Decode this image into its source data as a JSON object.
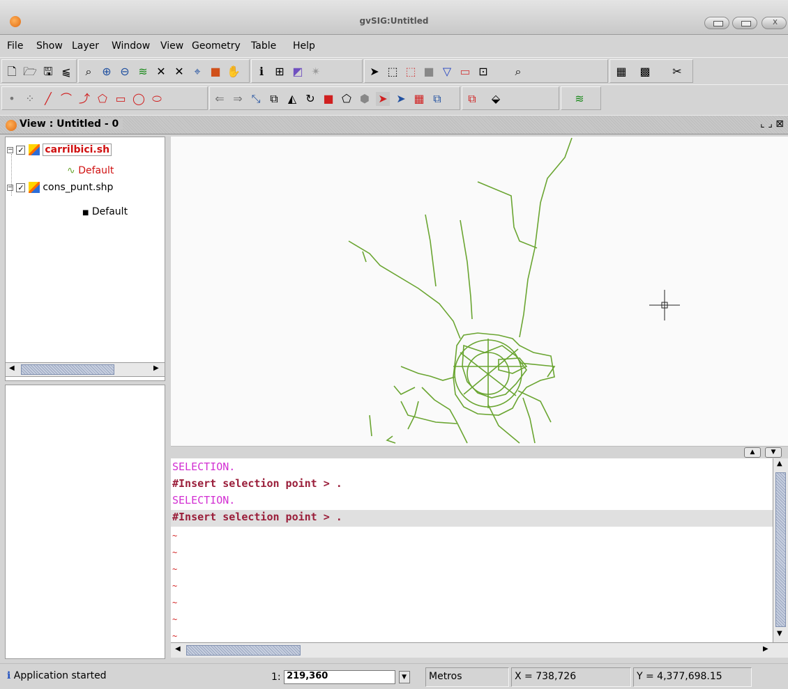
{
  "window": {
    "title": "gvSIG:Untitled"
  },
  "menu": [
    "File",
    "Show",
    "Layer",
    "Window",
    "View",
    "Geometry",
    "Table",
    "Help"
  ],
  "view": {
    "title": "View : Untitled - 0"
  },
  "toc": {
    "layers": [
      {
        "name": "carrilbici.sh",
        "legend": "Default",
        "checked": true,
        "active": true
      },
      {
        "name": "cons_punt.shp",
        "legend": "Default",
        "checked": true,
        "active": false
      }
    ]
  },
  "console": {
    "lines": [
      {
        "text": "SELECTION.",
        "kind": "sel"
      },
      {
        "text": "#Insert selection point > .",
        "kind": "ins"
      },
      {
        "text": "SELECTION.",
        "kind": "sel"
      },
      {
        "text": "#Insert selection point > .",
        "kind": "ins"
      }
    ],
    "tilde": "~"
  },
  "status": {
    "message": "Application started",
    "scale_prefix": "1:",
    "scale_value": "219,360",
    "units": "Metros",
    "x": "X = 738,726",
    "y": "Y = 4,377,698.15"
  },
  "colors": {
    "map_lines": "#6aa531",
    "console_select": "#d22fd2",
    "console_insert": "#9a1e3a"
  }
}
